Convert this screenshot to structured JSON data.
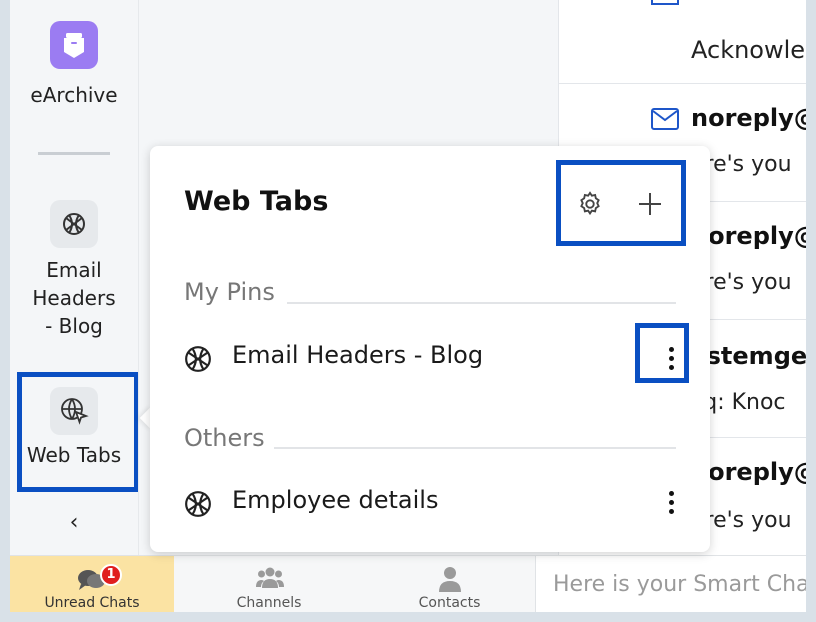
{
  "rail": {
    "apps": [
      {
        "label": "eArchive",
        "icon": "archive-icon"
      },
      {
        "label": "Email Headers - Blog",
        "icon": "globe-icon"
      },
      {
        "label": "Web Tabs",
        "icon": "globe-cursor-icon"
      }
    ],
    "collapse_glyph": "‹"
  },
  "popup": {
    "title": "Web Tabs",
    "sections": [
      {
        "name": "My Pins",
        "items": [
          {
            "label": "Email Headers - Blog"
          }
        ]
      },
      {
        "name": "Others",
        "items": [
          {
            "label": "Employee details"
          }
        ]
      }
    ]
  },
  "list": {
    "rows": [
      {
        "title": "",
        "sub": "Acknowle"
      },
      {
        "title": "noreply@",
        "sub": "ere's you"
      },
      {
        "title": "noreply@",
        "sub": "ere's you"
      },
      {
        "title": "ystemge",
        "sub": "liq: Knoc"
      },
      {
        "title": "noreply@",
        "sub": "ere's you"
      }
    ]
  },
  "bottom": {
    "tabs": [
      {
        "label": "Unread Chats",
        "badge": "1"
      },
      {
        "label": "Channels"
      },
      {
        "label": "Contacts"
      }
    ],
    "smart_chat_placeholder": "Here is your Smart Chat (Ctrl+Space)"
  },
  "colors": {
    "highlight": "#0a4fc2",
    "archive_accent": "#9b7cf2",
    "unread_tab_bg": "#fbe3a3",
    "badge_red": "#e01e1e"
  }
}
